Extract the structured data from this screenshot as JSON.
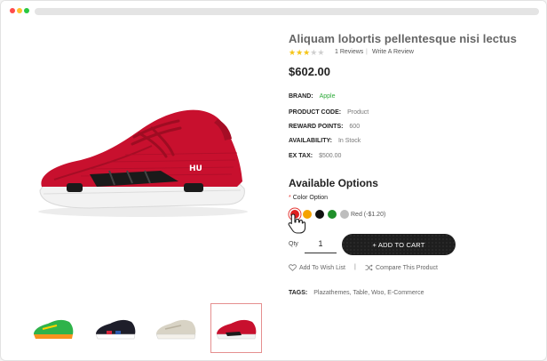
{
  "product": {
    "title": "Aliquam lobortis pellentesque nisi lectus",
    "rating": 3,
    "rating_max": 5,
    "reviews_label": "1 Reviews",
    "separator": "|",
    "write_review_label": "Write A Review",
    "price": "$602.00"
  },
  "info": [
    {
      "label": "BRAND:",
      "value": "Apple"
    },
    {
      "label": "PRODUCT CODE:",
      "value": "Product"
    },
    {
      "label": "REWARD POINTS:",
      "value": "600"
    },
    {
      "label": "AVAILABILITY:",
      "value": "In Stock"
    },
    {
      "label": "EX TAX:",
      "value": "$500.00"
    }
  ],
  "options": {
    "heading": "Available Options",
    "required_mark": "*",
    "color_label": "Color Option",
    "swatches": [
      {
        "name": "red",
        "color": "#e02020",
        "selected": true
      },
      {
        "name": "orange",
        "color": "#f5a300",
        "selected": false
      },
      {
        "name": "black",
        "color": "#111111",
        "selected": false
      },
      {
        "name": "green",
        "color": "#1f8f2a",
        "selected": false
      },
      {
        "name": "grey",
        "color": "#bdbdbd",
        "selected": false
      }
    ],
    "selected_label": "Red (-$1.20)"
  },
  "purchase": {
    "qty_label": "Qty",
    "qty_value": "1",
    "add_to_cart_label": "+ ADD TO CART",
    "wishlist_label": "Add To Wish List",
    "action_separator": "|",
    "compare_label": "Compare This Product"
  },
  "tags": {
    "label": "TAGS:",
    "items": [
      "Plazathemes",
      "Table",
      "Woo",
      "E-Commerce"
    ]
  },
  "thumbnails": [
    {
      "name": "green-orange-sneaker",
      "active": false
    },
    {
      "name": "black-sneaker",
      "active": false
    },
    {
      "name": "beige-sneaker",
      "active": false
    },
    {
      "name": "red-sneaker",
      "active": true
    }
  ],
  "colors": {
    "accent_link": "#2eaa3a",
    "star_on": "#f5c518",
    "star_off": "#cfcfcf",
    "button_bg": "#1e1e1e",
    "active_thumb_border": "#e58f8f",
    "shoe_primary": "#c8102e"
  },
  "icons": {
    "wishlist": "heart-icon",
    "compare": "shuffle-icon",
    "cursor": "hand-pointer-icon"
  }
}
